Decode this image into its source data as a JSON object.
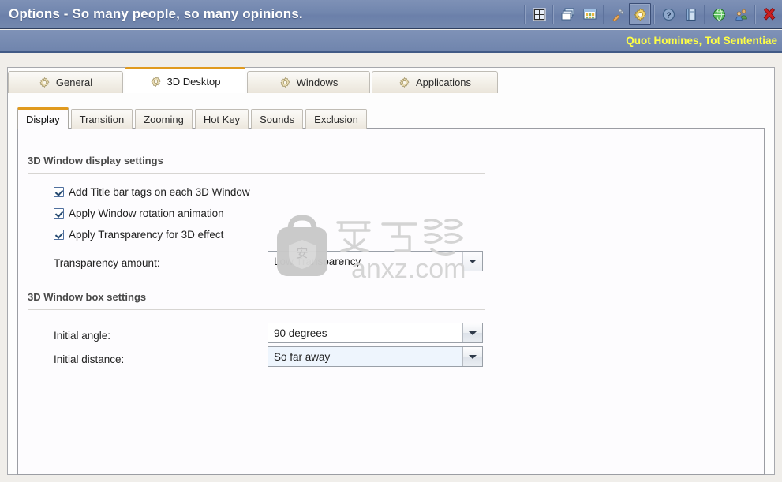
{
  "window": {
    "title": "Options - So many people, so many opinions.",
    "subtitle": "Quot Homines, Tot Sententiae",
    "accent_orange": "#e09a1e",
    "titlebar_blue": "#7186ae",
    "subtitle_yellow": "#ffff44"
  },
  "titlebar_tools": [
    {
      "name": "layout-grid-icon",
      "label": "Layout"
    },
    {
      "name": "cascade-windows-icon",
      "label": "Cascade Windows"
    },
    {
      "name": "tile-windows-icon",
      "label": "Tile Windows"
    },
    {
      "name": "tools-icon",
      "label": "Tools"
    },
    {
      "name": "options-gear-icon",
      "label": "Options"
    },
    {
      "name": "help-icon",
      "label": "Help"
    },
    {
      "name": "manual-book-icon",
      "label": "Manual"
    },
    {
      "name": "globe-icon",
      "label": "Website"
    },
    {
      "name": "support-people-icon",
      "label": "Support"
    },
    {
      "name": "close-icon",
      "label": "Close"
    }
  ],
  "primary_tabs": [
    {
      "label": "General",
      "active": false
    },
    {
      "label": "3D Desktop",
      "active": true
    },
    {
      "label": "Windows",
      "active": false
    },
    {
      "label": "Applications",
      "active": false
    }
  ],
  "secondary_tabs": [
    {
      "label": "Display",
      "active": true
    },
    {
      "label": "Transition",
      "active": false
    },
    {
      "label": "Zooming",
      "active": false
    },
    {
      "label": "Hot Key",
      "active": false
    },
    {
      "label": "Sounds",
      "active": false
    },
    {
      "label": "Exclusion",
      "active": false
    }
  ],
  "display_panel": {
    "section1_title": "3D Window display settings",
    "checkboxes": [
      {
        "label": "Add Title bar tags on each 3D Window",
        "checked": true
      },
      {
        "label": "Apply Window rotation animation",
        "checked": true
      },
      {
        "label": "Apply Transparency for 3D effect",
        "checked": true
      }
    ],
    "transparency_label": "Transparency amount:",
    "transparency_value": "Low Transparency",
    "section2_title": "3D Window box settings",
    "initial_angle_label": "Initial angle:",
    "initial_angle_value": "90 degrees",
    "initial_distance_label": "Initial distance:",
    "initial_distance_value": "So far away"
  },
  "watermark": {
    "text": "anxz.com",
    "cjk": "安下载"
  }
}
